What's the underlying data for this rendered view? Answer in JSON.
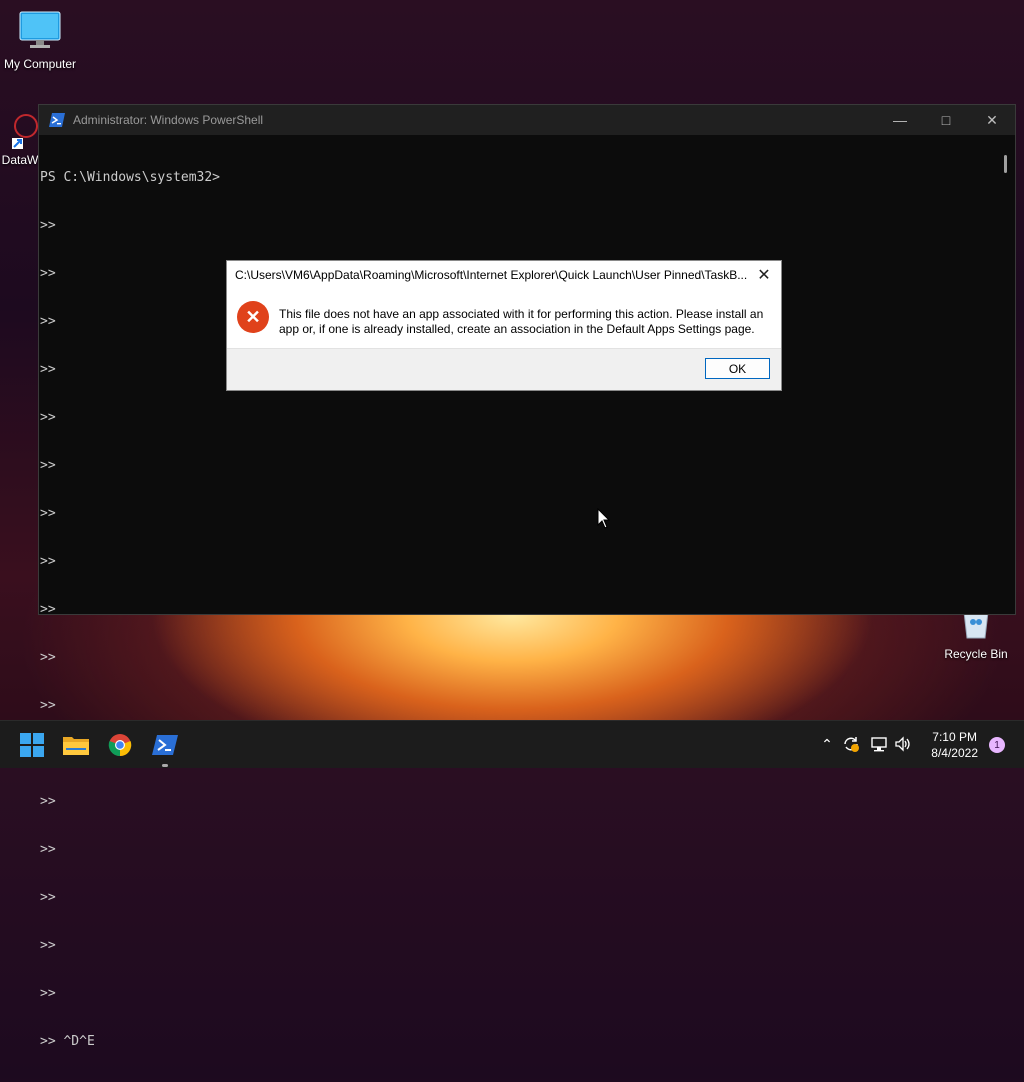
{
  "desktop": {
    "icons": [
      {
        "label": "My Computer"
      },
      {
        "label": "DataW"
      },
      {
        "label": "Recycle Bin"
      }
    ]
  },
  "powershell": {
    "title": "Administrator: Windows PowerShell",
    "lines": [
      "PS C:\\Windows\\system32>",
      ">>",
      ">>",
      ">>",
      ">>",
      ">>",
      ">>",
      ">>",
      ">>",
      ">>",
      ">>",
      ">>",
      ">>",
      ">>",
      ">>",
      ">>",
      ">>",
      ">>",
      ">> ^D^E"
    ]
  },
  "dialog": {
    "title": "C:\\Users\\VM6\\AppData\\Roaming\\Microsoft\\Internet Explorer\\Quick Launch\\User Pinned\\TaskB...",
    "message": "This file does not have an app associated with it for performing this action. Please install an app or, if one is already installed, create an association in the Default Apps Settings page.",
    "ok_label": "OK"
  },
  "taskbar": {
    "apps": [
      "start-icon",
      "file-explorer-icon",
      "chrome-icon",
      "powershell-icon"
    ],
    "time": "7:10 PM",
    "date": "8/4/2022",
    "notification_count": "1"
  }
}
